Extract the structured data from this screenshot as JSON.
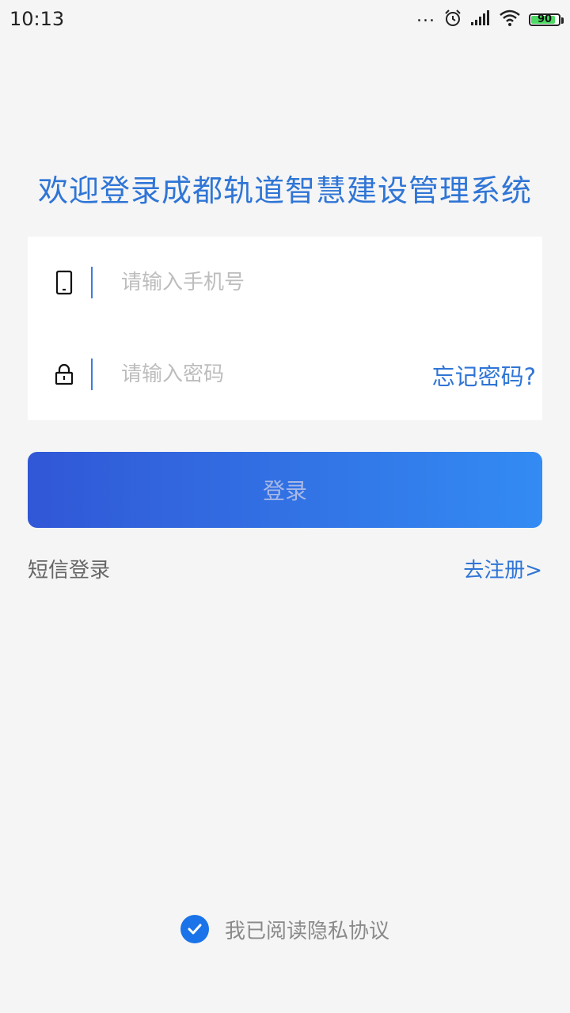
{
  "status_bar": {
    "time": "10:13",
    "dots": "...",
    "battery_level": 90,
    "battery_text": "90"
  },
  "title": "欢迎登录成都轨道智慧建设管理系统",
  "form": {
    "phone_placeholder": "请输入手机号",
    "password_placeholder": "请输入密码",
    "forgot_password": "忘记密码?"
  },
  "login_button": "登录",
  "links": {
    "sms_login": "短信登录",
    "register": "去注册>"
  },
  "agreement": {
    "checked": true,
    "text": "我已阅读隐私协议"
  },
  "colors": {
    "accent": "#2f75d6",
    "button_gradient_start": "#3157d6",
    "button_gradient_end": "#338bf3",
    "checkbox": "#1a73e8",
    "background": "#f5f5f5"
  },
  "icons": {
    "phone": "phone-icon",
    "lock": "lock-icon",
    "alarm": "alarm-icon",
    "signal": "signal-icon",
    "wifi": "wifi-icon",
    "battery": "battery-icon",
    "check": "check-icon"
  }
}
